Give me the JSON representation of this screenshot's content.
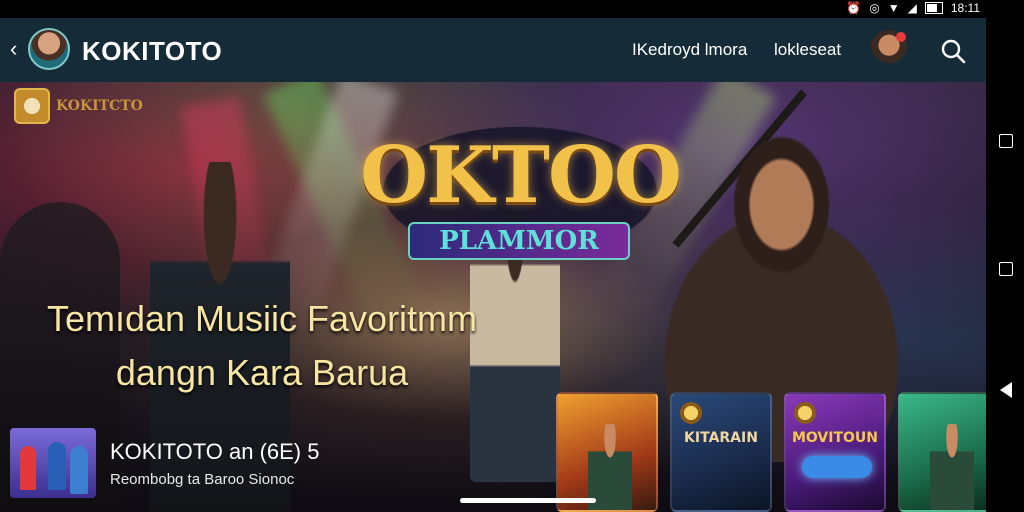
{
  "statusbar": {
    "time": "18:11"
  },
  "header": {
    "brand": "KOKITOTO",
    "nav_1": "IKedroyd lmora",
    "nav_2": "lokleseat"
  },
  "hero": {
    "small_logo_text": "KOKITCTO",
    "game_title": "OKTOO",
    "game_subtitle": "PLAMMOR",
    "headline_line1": "Temıdan Musiic Favoritmm",
    "headline_line2": "dangn Kara Barua"
  },
  "featured": {
    "title": "KOKITOTO an (6E) 5",
    "subtitle": "Reombobg ta Baroo Sionoc"
  },
  "cards": [
    {
      "label": ""
    },
    {
      "label": "KITARAIN"
    },
    {
      "label": "MOVITOUN"
    },
    {
      "label": ""
    }
  ],
  "colors": {
    "header_bg": "#152b37",
    "headline": "#f7e5a4",
    "logo_gold": "#f2c14a"
  }
}
